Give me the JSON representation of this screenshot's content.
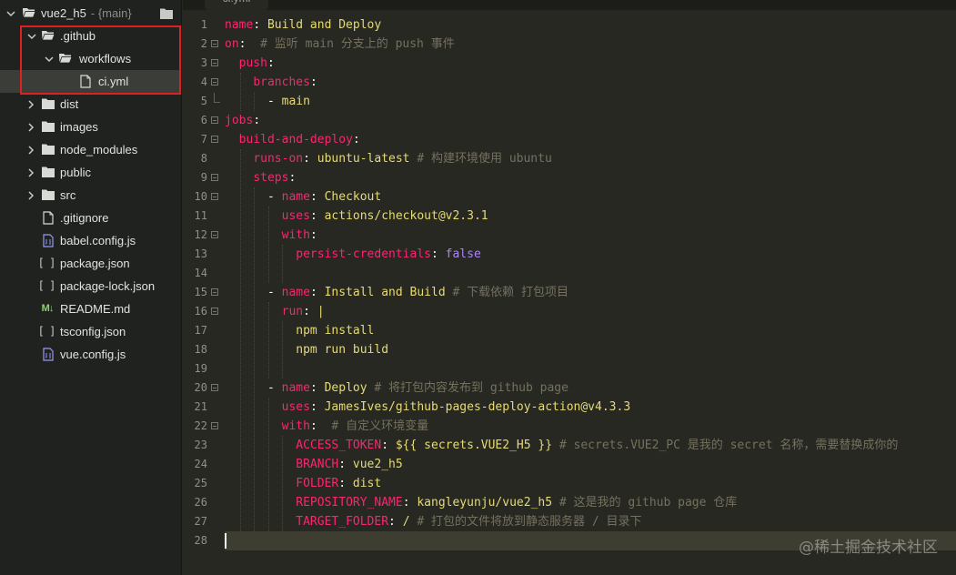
{
  "sidebar": {
    "root": {
      "name": "vue2_h5",
      "branch": "- {main}"
    },
    "rows": [
      {
        "label": "vue2_h5"
      },
      {
        "label": ".github"
      },
      {
        "label": "workflows"
      },
      {
        "label": "ci.yml"
      },
      {
        "label": "dist"
      },
      {
        "label": "images"
      },
      {
        "label": "node_modules"
      },
      {
        "label": "public"
      },
      {
        "label": "src"
      },
      {
        "label": ".gitignore"
      },
      {
        "label": "babel.config.js"
      },
      {
        "label": "package.json"
      },
      {
        "label": "package-lock.json"
      },
      {
        "label": "README.md"
      },
      {
        "label": "tsconfig.json"
      },
      {
        "label": "vue.config.js"
      }
    ]
  },
  "editor": {
    "tab_label": "ci.yml",
    "line_numbers": [
      "1",
      "2",
      "3",
      "4",
      "5",
      "6",
      "7",
      "8",
      "9",
      "10",
      "11",
      "12",
      "13",
      "14",
      "15",
      "16",
      "17",
      "18",
      "19",
      "20",
      "21",
      "22",
      "23",
      "24",
      "25",
      "26",
      "27",
      "28"
    ],
    "code": [
      {
        "k": "name",
        "s": "Build and Deploy"
      },
      {
        "k": "on",
        "c": "# 监听 main 分支上的 push 事件"
      },
      {
        "k": "push"
      },
      {
        "k": "branches"
      },
      {
        "s": "main"
      },
      {
        "k": "jobs"
      },
      {
        "k": "build-and-deploy"
      },
      {
        "k": "runs-on",
        "s": "ubuntu-latest",
        "c": "# 构建环境使用 ubuntu"
      },
      {
        "k": "steps"
      },
      {
        "k": "name",
        "s": "Checkout"
      },
      {
        "k": "uses",
        "s": "actions/checkout@v2.3.1"
      },
      {
        "k": "with"
      },
      {
        "k": "persist-credentials",
        "b": "false"
      },
      {},
      {
        "k": "name",
        "s": "Install and Build",
        "c": "# 下载依赖 打包项目"
      },
      {
        "k": "run",
        "s": "|"
      },
      {
        "s": "npm install"
      },
      {
        "s": "npm run build"
      },
      {},
      {
        "k": "name",
        "s": "Deploy",
        "c": "# 将打包内容发布到 github page"
      },
      {
        "k": "uses",
        "s": "JamesIves/github-pages-deploy-action@v4.3.3"
      },
      {
        "k": "with",
        "c": "# 自定义环境变量"
      },
      {
        "k": "ACCESS_TOKEN",
        "s": "${{ secrets.VUE2_H5 }}",
        "c": "# secrets.VUE2_PC 是我的 secret 名称，需要替换成你的"
      },
      {
        "k": "BRANCH",
        "s": "vue2_h5"
      },
      {
        "k": "FOLDER",
        "s": "dist"
      },
      {
        "k": "REPOSITORY_NAME",
        "s": "kangleyunju/vue2_h5",
        "c": "# 这是我的 github page 仓库"
      },
      {
        "k": "TARGET_FOLDER",
        "s": "/",
        "c": "# 打包的文件将放到静态服务器 / 目录下"
      },
      {}
    ]
  },
  "watermark": "@稀土掘金技术社区",
  "colors": {
    "keyword": "#f92672",
    "string": "#e6db74",
    "comment": "#75715e",
    "number": "#ae81ff",
    "highlight_box": "#e02020"
  }
}
